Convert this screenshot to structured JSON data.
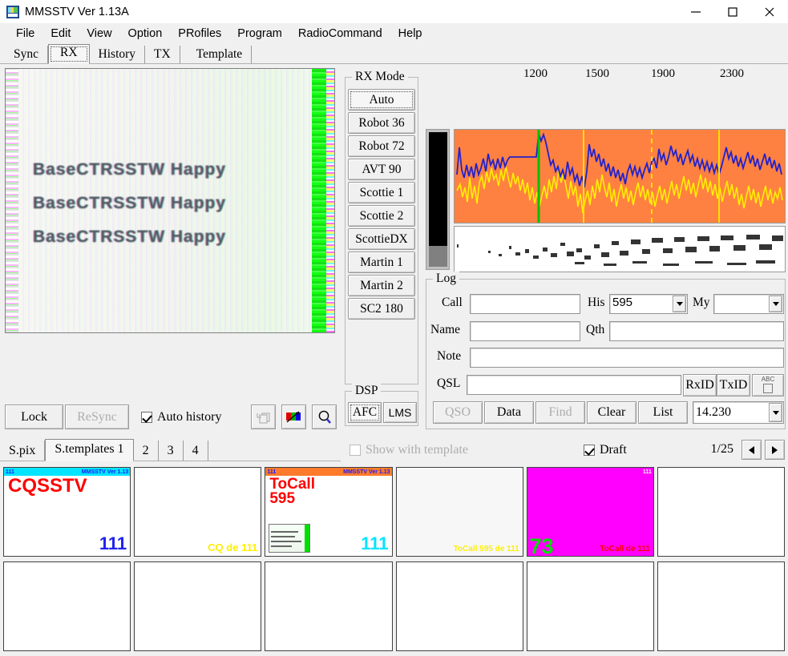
{
  "window": {
    "title": "MMSSTV Ver 1.13A",
    "icon": "sstv-app-icon",
    "controls": {
      "minimize": "─",
      "maximize": "□",
      "close": "✕"
    }
  },
  "menu": {
    "items": [
      "File",
      "Edit",
      "View",
      "Option",
      "PRofiles",
      "Program",
      "RadioCommand",
      "Help"
    ]
  },
  "top_tabs": {
    "selected": "RX",
    "items": [
      "Sync",
      "RX",
      "History",
      "TX",
      "Template"
    ]
  },
  "rx_image": {
    "caption_lines": [
      "BaseCTRSSTW Happy",
      "BaseCTRSSTW Happy",
      "BaseCTRSSTW Happy"
    ]
  },
  "rx_mode": {
    "label": "RX Mode",
    "selected": "Auto",
    "buttons": [
      "Auto",
      "Robot 36",
      "Robot 72",
      "AVT 90",
      "Scottie 1",
      "Scottie 2",
      "ScottieDX",
      "Martin 1",
      "Martin 2",
      "SC2 180"
    ]
  },
  "dsp": {
    "label": "DSP",
    "buttons": [
      "AFC",
      "LMS"
    ],
    "selected": "AFC"
  },
  "spectrum": {
    "tick_labels": [
      "1200",
      "1500",
      "1900",
      "2300"
    ],
    "background_color": "#FF8142",
    "trace_colors": {
      "blue": "#2222CC",
      "yellow": "#FFF000"
    },
    "marker_colors": {
      "green": "#00C000",
      "yellow_solid": "#FFE000",
      "yellow_dashed": "#FFE000"
    }
  },
  "log": {
    "label": "Log",
    "fields": {
      "call_label": "Call",
      "call_value": "",
      "his_label": "His",
      "his_value": "595",
      "my_label": "My",
      "my_value": "",
      "name_label": "Name",
      "name_value": "",
      "qth_label": "Qth",
      "qth_value": "",
      "note_label": "Note",
      "note_value": "",
      "qsl_label": "QSL",
      "qsl_value": ""
    },
    "id_buttons": [
      "RxID",
      "TxID"
    ],
    "abc_button": "ABC",
    "action_buttons": [
      {
        "label": "QSO",
        "enabled": false
      },
      {
        "label": "Data",
        "enabled": true
      },
      {
        "label": "Find",
        "enabled": false
      },
      {
        "label": "Clear",
        "enabled": true
      },
      {
        "label": "List",
        "enabled": true
      }
    ],
    "frequency": "14.230"
  },
  "control_bar": {
    "lock": {
      "label": "Lock",
      "enabled": true
    },
    "resync": {
      "label": "ReSync",
      "enabled": false
    },
    "auto_history": {
      "label": "Auto history",
      "checked": true
    },
    "icons": [
      "copy-pages-icon",
      "rgb-levels-icon",
      "magnifier-icon"
    ]
  },
  "bottom_tabs": {
    "selected": "S.templates 1",
    "items": [
      "S.pix",
      "S.templates 1",
      "2",
      "3",
      "4"
    ]
  },
  "template_options": {
    "show_with_template": {
      "label": "Show with template",
      "checked": false,
      "enabled": false
    },
    "draft": {
      "label": "Draft",
      "checked": true
    },
    "page": "1/25",
    "prev": "◄",
    "next": "►"
  },
  "thumbnails": [
    {
      "id": 1,
      "header": {
        "left": "111",
        "right": "MMSSTV Ver 1.13",
        "color": "#00E5FF"
      },
      "big_text": "CQSSTV",
      "big_color": "#FF0000",
      "corner_text": "111",
      "corner_color": "#2222EE",
      "bg": "#ffffff",
      "embedded": false
    },
    {
      "id": 2,
      "header": null,
      "big_text": "",
      "big_color": "",
      "corner_text": "CQ de 111",
      "corner_color": "#FFF000",
      "bg": "#ffffff",
      "embedded": false
    },
    {
      "id": 3,
      "header": {
        "left": "111",
        "right": "MMSSTV Ver 1.13",
        "color": "#FF7A2A"
      },
      "big_text": "ToCall\n595",
      "big_color": "#FF0000",
      "corner_text": "111",
      "corner_color": "#00E5FF",
      "bg": "#ffffff",
      "embedded": true
    },
    {
      "id": 4,
      "header": null,
      "big_text": "",
      "big_color": "",
      "corner_text": "ToCall 595 de 111",
      "corner_color": "#FFF000",
      "bg": "#f7f7f7",
      "embedded": false
    },
    {
      "id": 5,
      "header": {
        "left": "",
        "right": "111",
        "color": "#FF00FF"
      },
      "big_text": "73",
      "big_color": "#00E000",
      "corner_text": "ToCall de 111",
      "corner_color": "#FF0000",
      "bg": "#FF00FF",
      "embedded": false
    },
    {
      "id": 6,
      "header": null,
      "big_text": "",
      "big_color": "",
      "corner_text": "",
      "corner_color": "",
      "bg": "#ffffff",
      "embedded": false
    },
    {
      "id": 7,
      "header": null,
      "big_text": "",
      "big_color": "",
      "corner_text": "",
      "corner_color": "",
      "bg": "#ffffff",
      "embedded": false
    },
    {
      "id": 8,
      "header": null,
      "big_text": "",
      "big_color": "",
      "corner_text": "",
      "corner_color": "",
      "bg": "#ffffff",
      "embedded": false
    },
    {
      "id": 9,
      "header": null,
      "big_text": "",
      "big_color": "",
      "corner_text": "",
      "corner_color": "",
      "bg": "#ffffff",
      "embedded": false
    },
    {
      "id": 10,
      "header": null,
      "big_text": "",
      "big_color": "",
      "corner_text": "",
      "corner_color": "",
      "bg": "#ffffff",
      "embedded": false
    },
    {
      "id": 11,
      "header": null,
      "big_text": "",
      "big_color": "",
      "corner_text": "",
      "corner_color": "",
      "bg": "#ffffff",
      "embedded": false
    },
    {
      "id": 12,
      "header": null,
      "big_text": "",
      "big_color": "",
      "corner_text": "",
      "corner_color": "",
      "bg": "#ffffff",
      "embedded": false
    }
  ]
}
